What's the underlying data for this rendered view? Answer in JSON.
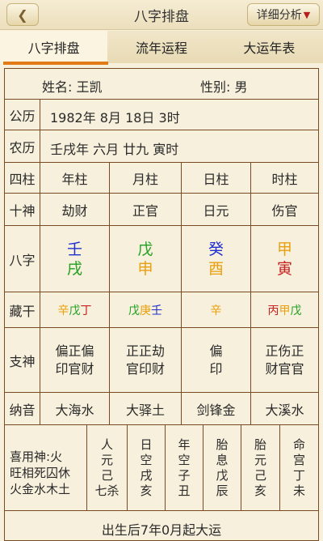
{
  "header": {
    "back_icon": "chevron-left-icon",
    "title": "八字排盘",
    "detail_label": "详细分析",
    "detail_arrow": "▼"
  },
  "tabs": [
    {
      "label": "八字排盘",
      "active": true
    },
    {
      "label": "流年运程",
      "active": false
    },
    {
      "label": "大运年表",
      "active": false
    }
  ],
  "info": {
    "name_label": "姓名:",
    "name_value": "王凯",
    "gender_label": "性别:",
    "gender_value": "男",
    "gongli_label": "公历",
    "gongli_value": "1982年 8月 18日 3时",
    "nongli_label": "农历",
    "nongli_value": "壬戌年 六月 廿九 寅时"
  },
  "pillars": {
    "label": "四柱",
    "cols": [
      "年柱",
      "月柱",
      "日柱",
      "时柱"
    ]
  },
  "shishen": {
    "label": "十神",
    "values": [
      "劫财",
      "正官",
      "日元",
      "伤官"
    ]
  },
  "bazi": {
    "label": "八字",
    "stems": [
      {
        "text": "壬",
        "color": "#2030d0"
      },
      {
        "text": "戊",
        "color": "#22a022"
      },
      {
        "text": "癸",
        "color": "#2030d0"
      },
      {
        "text": "甲",
        "color": "#e8a010"
      }
    ],
    "branches": [
      {
        "text": "戌",
        "color": "#22a022"
      },
      {
        "text": "申",
        "color": "#e8a010"
      },
      {
        "text": "酉",
        "color": "#e8a010"
      },
      {
        "text": "寅",
        "color": "#c62020"
      }
    ]
  },
  "canggan": {
    "label": "藏干",
    "cells": [
      [
        {
          "text": "辛",
          "color": "#e8a010"
        },
        {
          "text": "戊",
          "color": "#22a022"
        },
        {
          "text": "丁",
          "color": "#c62020"
        }
      ],
      [
        {
          "text": "戊",
          "color": "#22a022"
        },
        {
          "text": "庚",
          "color": "#e8a010"
        },
        {
          "text": "壬",
          "color": "#2030d0"
        }
      ],
      [
        {
          "text": "辛",
          "color": "#e8a010"
        }
      ],
      [
        {
          "text": "丙",
          "color": "#c62020"
        },
        {
          "text": "甲",
          "color": "#e8a010"
        },
        {
          "text": "戊",
          "color": "#22a022"
        }
      ]
    ]
  },
  "zhishen": {
    "label": "支神",
    "cells": [
      [
        "偏正偏",
        "印官财"
      ],
      [
        "正正劫",
        "官印财"
      ],
      [
        "偏",
        "印"
      ],
      [
        "正伤正",
        "财官官"
      ]
    ]
  },
  "nayin": {
    "label": "纳音",
    "values": [
      "大海水",
      "大驿土",
      "剑锋金",
      "大溪水"
    ]
  },
  "bottom": {
    "xiyong_label": "喜用神:",
    "xiyong_value": "火",
    "wangxiang_line1": "旺相死囚休",
    "wangxiang_line2": "火金水木土",
    "columns": [
      [
        "人",
        "元",
        "己",
        "七杀"
      ],
      [
        "日",
        "空",
        "戌",
        "亥"
      ],
      [
        "年",
        "空",
        "子",
        "丑"
      ],
      [
        "胎",
        "息",
        "戊",
        "辰"
      ],
      [
        "胎",
        "元",
        "己",
        "亥"
      ],
      [
        "命",
        "宫",
        "丁",
        "未"
      ]
    ],
    "footer_text": "出生后7年0月起大运"
  }
}
